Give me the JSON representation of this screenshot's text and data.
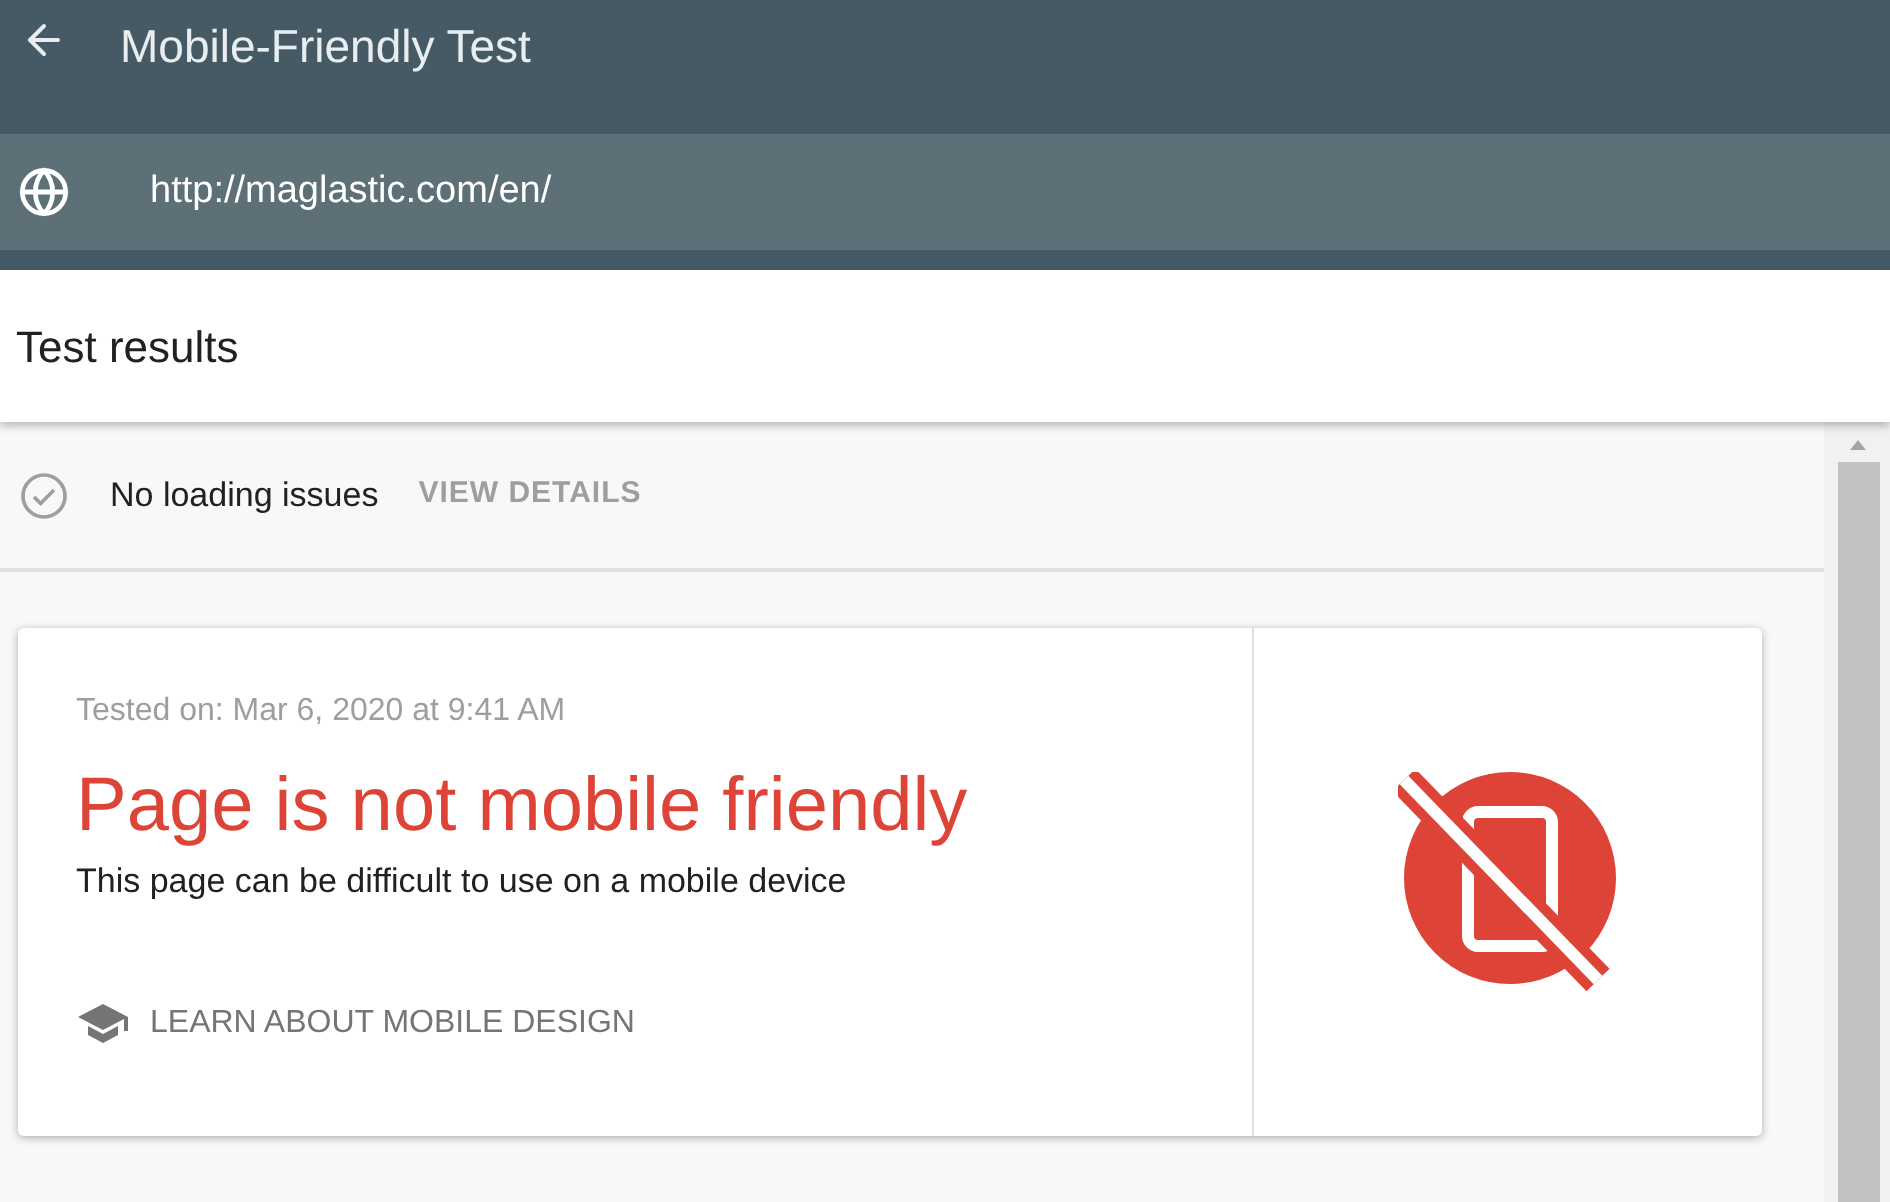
{
  "header": {
    "title": "Mobile-Friendly Test"
  },
  "url_bar": {
    "url": "http://maglastic.com/en/"
  },
  "section": {
    "title": "Test results"
  },
  "loading": {
    "status": "No loading issues",
    "link": "VIEW DETAILS"
  },
  "result": {
    "tested_on": "Tested on: Mar 6, 2020 at 9:41 AM",
    "headline": "Page is not mobile friendly",
    "description": "This page can be difficult to use on a mobile device",
    "learn_link": "LEARN ABOUT MOBILE DESIGN",
    "mobile_friendly": false
  }
}
